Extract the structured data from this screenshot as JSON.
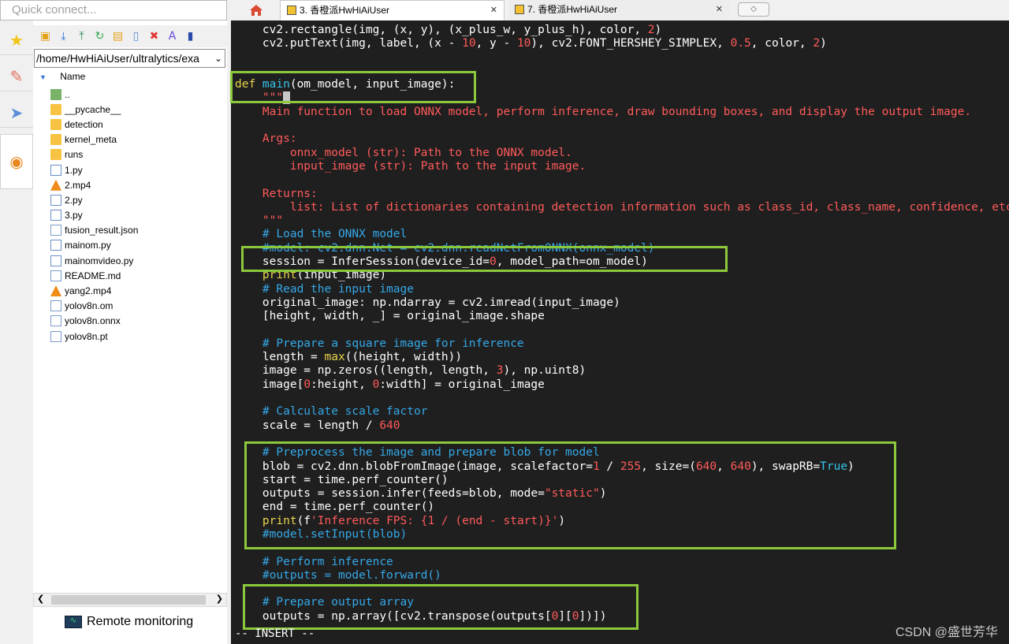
{
  "quick_connect": {
    "placeholder": "Quick connect..."
  },
  "tabs": [
    {
      "label": "3. 香橙派HwHiAiUser",
      "close": "✕"
    },
    {
      "label": "7. 香橙派HwHiAiUser",
      "close": "✕"
    }
  ],
  "new_tab_glyph": "◇",
  "file_panel": {
    "path": "/home/HwHiAiUser/ultralytics/exa",
    "column_header": "Name",
    "files": [
      {
        "name": "..",
        "type": "up"
      },
      {
        "name": "__pycache__",
        "type": "folder"
      },
      {
        "name": "detection",
        "type": "folder"
      },
      {
        "name": "kernel_meta",
        "type": "folder"
      },
      {
        "name": "runs",
        "type": "folder"
      },
      {
        "name": "1.py",
        "type": "py"
      },
      {
        "name": "2.mp4",
        "type": "vlc"
      },
      {
        "name": "2.py",
        "type": "py"
      },
      {
        "name": "3.py",
        "type": "py"
      },
      {
        "name": "fusion_result.json",
        "type": "doc"
      },
      {
        "name": "mainom.py",
        "type": "py"
      },
      {
        "name": "mainomvideo.py",
        "type": "py"
      },
      {
        "name": "README.md",
        "type": "doc"
      },
      {
        "name": "yang2.mp4",
        "type": "vlc"
      },
      {
        "name": "yolov8n.om",
        "type": "doc"
      },
      {
        "name": "yolov8n.onnx",
        "type": "doc"
      },
      {
        "name": "yolov8n.pt",
        "type": "doc"
      }
    ],
    "remote_monitoring": "Remote monitoring"
  },
  "editor": {
    "code_lines": [
      [
        [
          "",
          "    cv2.rectangle(img, (x, y), (x_plus_w, y_plus_h), color, "
        ],
        [
          "num",
          "2"
        ],
        [
          "",
          ")"
        ]
      ],
      [
        [
          "",
          "    cv2.putText(img, label, (x - "
        ],
        [
          "num",
          "10"
        ],
        [
          "",
          ", y - "
        ],
        [
          "num",
          "10"
        ],
        [
          "",
          "), cv2.FONT_HERSHEY_SIMPLEX, "
        ],
        [
          "num",
          "0.5"
        ],
        [
          "",
          ", color, "
        ],
        [
          "num",
          "2"
        ],
        [
          "",
          ")"
        ]
      ],
      [
        [
          "",
          ""
        ]
      ],
      [
        [
          "",
          ""
        ]
      ],
      [
        [
          "kw",
          "def "
        ],
        [
          "fn",
          "main"
        ],
        [
          "",
          "(om_model, input_image):"
        ]
      ],
      [
        [
          "doc",
          "    \"\"\""
        ],
        [
          "cursor",
          "_"
        ]
      ],
      [
        [
          "doc",
          "    Main function to load ONNX model, perform inference, draw bounding boxes, and display the output image."
        ]
      ],
      [
        [
          "",
          ""
        ]
      ],
      [
        [
          "doc",
          "    Args:"
        ]
      ],
      [
        [
          "doc",
          "        onnx_model (str): Path to the ONNX model."
        ]
      ],
      [
        [
          "doc",
          "        input_image (str): Path to the input image."
        ]
      ],
      [
        [
          "",
          ""
        ]
      ],
      [
        [
          "doc",
          "    Returns:"
        ]
      ],
      [
        [
          "doc",
          "        list: List of dictionaries containing detection information such as class_id, class_name, confidence, etc."
        ]
      ],
      [
        [
          "doc",
          "    \"\"\""
        ]
      ],
      [
        [
          "cm",
          "    # Load the ONNX model"
        ]
      ],
      [
        [
          "cm",
          "    #model: cv2.dnn.Net = cv2.dnn.readNetFromONNX(onnx_model)"
        ]
      ],
      [
        [
          "",
          "    session = InferSession(device_id="
        ],
        [
          "num",
          "0"
        ],
        [
          "",
          ", model_path=om_model)"
        ]
      ],
      [
        [
          "bt",
          "    print"
        ],
        [
          "",
          "(input_image)"
        ]
      ],
      [
        [
          "cm",
          "    # Read the input image"
        ]
      ],
      [
        [
          "",
          "    original_image: np.ndarray = cv2.imread(input_image)"
        ]
      ],
      [
        [
          "",
          "    [height, width, _] = original_image.shape"
        ]
      ],
      [
        [
          "",
          ""
        ]
      ],
      [
        [
          "cm",
          "    # Prepare a square image for inference"
        ]
      ],
      [
        [
          "",
          "    length = "
        ],
        [
          "bt",
          "max"
        ],
        [
          "",
          "((height, width))"
        ]
      ],
      [
        [
          "",
          "    image = np.zeros((length, length, "
        ],
        [
          "num",
          "3"
        ],
        [
          "",
          "), np.uint8)"
        ]
      ],
      [
        [
          "",
          "    image["
        ],
        [
          "num",
          "0"
        ],
        [
          "",
          ":height, "
        ],
        [
          "num",
          "0"
        ],
        [
          "",
          ":width] = original_image"
        ]
      ],
      [
        [
          "",
          ""
        ]
      ],
      [
        [
          "cm",
          "    # Calculate scale factor"
        ]
      ],
      [
        [
          "",
          "    scale = length / "
        ],
        [
          "num",
          "640"
        ]
      ],
      [
        [
          "",
          ""
        ]
      ],
      [
        [
          "cm",
          "    # Preprocess the image and prepare blob for model"
        ]
      ],
      [
        [
          "",
          "    blob = cv2.dnn.blobFromImage(image, scalefactor="
        ],
        [
          "num",
          "1"
        ],
        [
          "",
          " / "
        ],
        [
          "num",
          "255"
        ],
        [
          "",
          ", size=("
        ],
        [
          "num",
          "640"
        ],
        [
          "",
          ", "
        ],
        [
          "num",
          "640"
        ],
        [
          "",
          "), swapRB="
        ],
        [
          "fn",
          "True"
        ],
        [
          "",
          ")"
        ]
      ],
      [
        [
          "",
          "    start = time.perf_counter()"
        ]
      ],
      [
        [
          "",
          "    outputs = session.infer(feeds=blob, mode="
        ],
        [
          "str",
          "\"static\""
        ],
        [
          "",
          ")"
        ]
      ],
      [
        [
          "",
          "    end = time.perf_counter()"
        ]
      ],
      [
        [
          "bt",
          "    print"
        ],
        [
          "",
          "(f"
        ],
        [
          "str",
          "'Inference FPS: {1 / (end - start)}'"
        ],
        [
          "",
          ")"
        ]
      ],
      [
        [
          "cm",
          "    #model.setInput(blob)"
        ]
      ],
      [
        [
          "",
          ""
        ]
      ],
      [
        [
          "cm",
          "    # Perform inference"
        ]
      ],
      [
        [
          "cm",
          "    #outputs = model.forward()"
        ]
      ],
      [
        [
          "",
          ""
        ]
      ],
      [
        [
          "cm",
          "    # Prepare output array"
        ]
      ],
      [
        [
          "",
          "    outputs = np.array([cv2.transpose(outputs["
        ],
        [
          "num",
          "0"
        ],
        [
          "",
          "]["
        ],
        [
          "num",
          "0"
        ],
        [
          "",
          "])])"
        ]
      ]
    ],
    "status": "-- INSERT --"
  },
  "watermark": "CSDN @盛世芳华"
}
